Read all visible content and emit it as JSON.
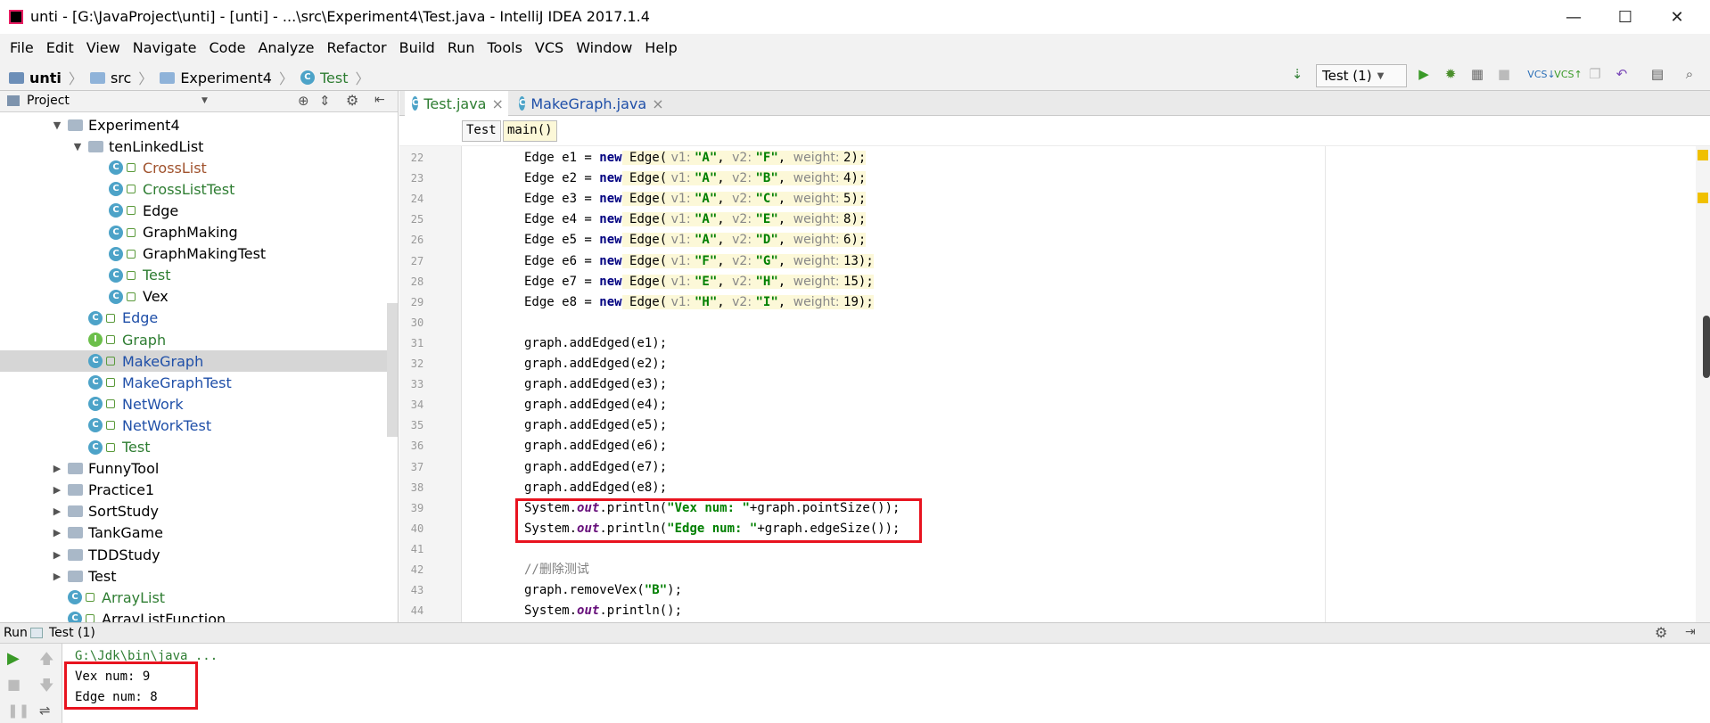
{
  "window": {
    "title": "unti - [G:\\JavaProject\\unti] - [unti] - ...\\src\\Experiment4\\Test.java - IntelliJ IDEA 2017.1.4",
    "minimize": "—",
    "maximize": "☐",
    "close": "✕"
  },
  "menu": [
    "File",
    "Edit",
    "View",
    "Navigate",
    "Code",
    "Analyze",
    "Refactor",
    "Build",
    "Run",
    "Tools",
    "VCS",
    "Window",
    "Help"
  ],
  "breadcrumb": [
    "unti",
    "src",
    "Experiment4",
    "Test"
  ],
  "run_config": "Test (1)",
  "project_panel": {
    "title": "Project",
    "tree": [
      {
        "label": "Experiment4",
        "type": "folder",
        "depth": 2,
        "expanded": true,
        "color": "#000000"
      },
      {
        "label": "tenLinkedList",
        "type": "folder",
        "depth": 3,
        "expanded": true,
        "color": "#000000"
      },
      {
        "label": "CrossList",
        "type": "class",
        "depth": 4,
        "color": "#a0522d"
      },
      {
        "label": "CrossListTest",
        "type": "class",
        "depth": 4,
        "color": "#2e7d32"
      },
      {
        "label": "Edge",
        "type": "class",
        "depth": 4,
        "color": "#000000"
      },
      {
        "label": "GraphMaking",
        "type": "class",
        "depth": 4,
        "color": "#000000"
      },
      {
        "label": "GraphMakingTest",
        "type": "class",
        "depth": 4,
        "color": "#000000"
      },
      {
        "label": "Test",
        "type": "class",
        "depth": 4,
        "color": "#2e7d32"
      },
      {
        "label": "Vex",
        "type": "class",
        "depth": 4,
        "color": "#000000"
      },
      {
        "label": "Edge",
        "type": "class",
        "depth": 3,
        "color": "#1f4fa8"
      },
      {
        "label": "Graph",
        "type": "interface",
        "depth": 3,
        "color": "#2e7d32"
      },
      {
        "label": "MakeGraph",
        "type": "class",
        "depth": 3,
        "color": "#1f4fa8",
        "selected": true
      },
      {
        "label": "MakeGraphTest",
        "type": "class",
        "depth": 3,
        "color": "#1f4fa8"
      },
      {
        "label": "NetWork",
        "type": "class",
        "depth": 3,
        "color": "#1f4fa8"
      },
      {
        "label": "NetWorkTest",
        "type": "class",
        "depth": 3,
        "color": "#1f4fa8"
      },
      {
        "label": "Test",
        "type": "class",
        "depth": 3,
        "color": "#2e7d32"
      },
      {
        "label": "FunnyTool",
        "type": "folder",
        "depth": 2,
        "expanded": false,
        "color": "#000000"
      },
      {
        "label": "Practice1",
        "type": "folder",
        "depth": 2,
        "expanded": false,
        "color": "#000000"
      },
      {
        "label": "SortStudy",
        "type": "folder",
        "depth": 2,
        "expanded": false,
        "color": "#000000"
      },
      {
        "label": "TankGame",
        "type": "folder",
        "depth": 2,
        "expanded": false,
        "color": "#000000"
      },
      {
        "label": "TDDStudy",
        "type": "folder",
        "depth": 2,
        "expanded": false,
        "color": "#000000"
      },
      {
        "label": "Test",
        "type": "folder",
        "depth": 2,
        "expanded": false,
        "color": "#000000"
      },
      {
        "label": "ArrayList",
        "type": "class",
        "depth": 2,
        "color": "#2e7d32"
      },
      {
        "label": "ArrayListFunction",
        "type": "class",
        "depth": 2,
        "color": "#000000"
      }
    ]
  },
  "tabs": [
    {
      "label": "Test.java",
      "close": "×",
      "active": true
    },
    {
      "label": "MakeGraph.java",
      "close": "×",
      "active": false
    }
  ],
  "editor_breadcrumb": [
    "Test",
    "main()"
  ],
  "code_lines": [
    {
      "n": "22",
      "segs": [
        [
          "p",
          "Edge e1 = "
        ],
        [
          "kw",
          "new"
        ],
        [
          "p",
          " Edge("
        ],
        [
          "hint",
          " v1: "
        ],
        [
          "str",
          "\"A\""
        ],
        [
          "p",
          ", "
        ],
        [
          "hint",
          "v2: "
        ],
        [
          "str",
          "\"F\""
        ],
        [
          "p",
          ", "
        ],
        [
          "hint",
          "weight: "
        ],
        [
          "p",
          "2);"
        ]
      ]
    },
    {
      "n": "23",
      "segs": [
        [
          "p",
          "Edge e2 = "
        ],
        [
          "kw",
          "new"
        ],
        [
          "p",
          " Edge("
        ],
        [
          "hint",
          " v1: "
        ],
        [
          "str",
          "\"A\""
        ],
        [
          "p",
          ", "
        ],
        [
          "hint",
          "v2: "
        ],
        [
          "str",
          "\"B\""
        ],
        [
          "p",
          ", "
        ],
        [
          "hint",
          "weight: "
        ],
        [
          "p",
          "4);"
        ]
      ]
    },
    {
      "n": "24",
      "segs": [
        [
          "p",
          "Edge e3 = "
        ],
        [
          "kw",
          "new"
        ],
        [
          "p",
          " Edge("
        ],
        [
          "hint",
          " v1: "
        ],
        [
          "str",
          "\"A\""
        ],
        [
          "p",
          ", "
        ],
        [
          "hint",
          "v2: "
        ],
        [
          "str",
          "\"C\""
        ],
        [
          "p",
          ", "
        ],
        [
          "hint",
          "weight: "
        ],
        [
          "p",
          "5);"
        ]
      ]
    },
    {
      "n": "25",
      "segs": [
        [
          "p",
          "Edge e4 = "
        ],
        [
          "kw",
          "new"
        ],
        [
          "p",
          " Edge("
        ],
        [
          "hint",
          " v1: "
        ],
        [
          "str",
          "\"A\""
        ],
        [
          "p",
          ", "
        ],
        [
          "hint",
          "v2: "
        ],
        [
          "str",
          "\"E\""
        ],
        [
          "p",
          ", "
        ],
        [
          "hint",
          "weight: "
        ],
        [
          "p",
          "8);"
        ]
      ]
    },
    {
      "n": "26",
      "segs": [
        [
          "p",
          "Edge e5 = "
        ],
        [
          "kw",
          "new"
        ],
        [
          "p",
          " Edge("
        ],
        [
          "hint",
          " v1: "
        ],
        [
          "str",
          "\"A\""
        ],
        [
          "p",
          ", "
        ],
        [
          "hint",
          "v2: "
        ],
        [
          "str",
          "\"D\""
        ],
        [
          "p",
          ", "
        ],
        [
          "hint",
          "weight: "
        ],
        [
          "p",
          "6);"
        ]
      ]
    },
    {
      "n": "27",
      "segs": [
        [
          "p",
          "Edge e6 = "
        ],
        [
          "kw",
          "new"
        ],
        [
          "p",
          " Edge("
        ],
        [
          "hint",
          " v1: "
        ],
        [
          "str",
          "\"F\""
        ],
        [
          "p",
          ", "
        ],
        [
          "hint",
          "v2: "
        ],
        [
          "str",
          "\"G\""
        ],
        [
          "p",
          ", "
        ],
        [
          "hint",
          "weight: "
        ],
        [
          "p",
          "13);"
        ]
      ]
    },
    {
      "n": "28",
      "segs": [
        [
          "p",
          "Edge e7 = "
        ],
        [
          "kw",
          "new"
        ],
        [
          "p",
          " Edge("
        ],
        [
          "hint",
          " v1: "
        ],
        [
          "str",
          "\"E\""
        ],
        [
          "p",
          ", "
        ],
        [
          "hint",
          "v2: "
        ],
        [
          "str",
          "\"H\""
        ],
        [
          "p",
          ", "
        ],
        [
          "hint",
          "weight: "
        ],
        [
          "p",
          "15);"
        ]
      ]
    },
    {
      "n": "29",
      "segs": [
        [
          "p",
          "Edge e8 = "
        ],
        [
          "kw",
          "new"
        ],
        [
          "p",
          " Edge("
        ],
        [
          "hint",
          " v1: "
        ],
        [
          "str",
          "\"H\""
        ],
        [
          "p",
          ", "
        ],
        [
          "hint",
          "v2: "
        ],
        [
          "str",
          "\"I\""
        ],
        [
          "p",
          ", "
        ],
        [
          "hint",
          "weight: "
        ],
        [
          "p",
          "19);"
        ]
      ]
    },
    {
      "n": "30",
      "segs": []
    },
    {
      "n": "31",
      "segs": [
        [
          "p",
          "graph.addEdged(e1);"
        ]
      ]
    },
    {
      "n": "32",
      "segs": [
        [
          "p",
          "graph.addEdged(e2);"
        ]
      ]
    },
    {
      "n": "33",
      "segs": [
        [
          "p",
          "graph.addEdged(e3);"
        ]
      ]
    },
    {
      "n": "34",
      "segs": [
        [
          "p",
          "graph.addEdged(e4);"
        ]
      ]
    },
    {
      "n": "35",
      "segs": [
        [
          "p",
          "graph.addEdged(e5);"
        ]
      ]
    },
    {
      "n": "36",
      "segs": [
        [
          "p",
          "graph.addEdged(e6);"
        ]
      ]
    },
    {
      "n": "37",
      "segs": [
        [
          "p",
          "graph.addEdged(e7);"
        ]
      ]
    },
    {
      "n": "38",
      "segs": [
        [
          "p",
          "graph.addEdged(e8);"
        ]
      ]
    },
    {
      "n": "39",
      "segs": [
        [
          "p",
          "System."
        ],
        [
          "ital",
          "out"
        ],
        [
          "p",
          ".println("
        ],
        [
          "str",
          "\"Vex num: \""
        ],
        [
          "p",
          "+graph.pointSize());"
        ]
      ]
    },
    {
      "n": "40",
      "segs": [
        [
          "p",
          "System."
        ],
        [
          "ital",
          "out"
        ],
        [
          "p",
          ".println("
        ],
        [
          "str",
          "\"Edge num: \""
        ],
        [
          "p",
          "+graph.edgeSize());"
        ]
      ]
    },
    {
      "n": "41",
      "segs": []
    },
    {
      "n": "42",
      "segs": [
        [
          "cmt",
          "//删除测试"
        ]
      ]
    },
    {
      "n": "43",
      "segs": [
        [
          "p",
          "graph.removeVex("
        ],
        [
          "str",
          "\"B\""
        ],
        [
          "p",
          ");"
        ]
      ]
    },
    {
      "n": "44",
      "segs": [
        [
          "p",
          "System."
        ],
        [
          "ital",
          "out"
        ],
        [
          "p",
          ".println();"
        ]
      ]
    }
  ],
  "run_panel": {
    "label": "Run",
    "config": "Test (1)",
    "console": [
      "G:\\Jdk\\bin\\java ...",
      "Vex num: 9",
      "Edge num: 8"
    ]
  },
  "colors": {
    "highlight_box": "#e8131f",
    "accent": "#2e7d32"
  }
}
